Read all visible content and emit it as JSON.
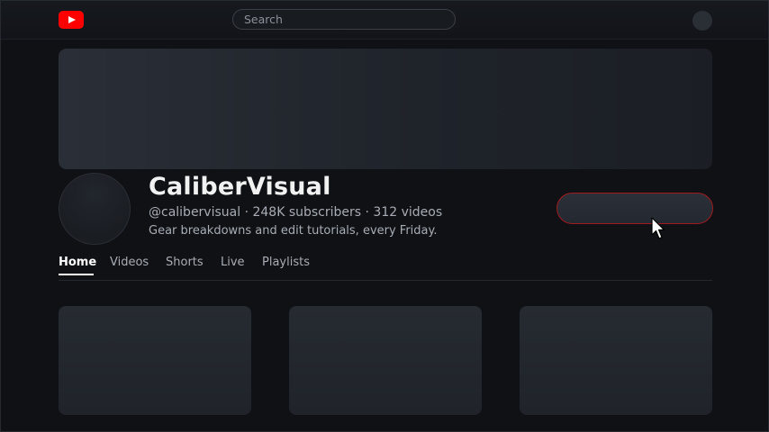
{
  "header": {
    "logo": "youtube-logo",
    "search_placeholder": "Search"
  },
  "channel": {
    "name": "CaliberVisual",
    "meta": "@calibervisual · 248K subscribers · 312 videos",
    "description": "Gear breakdowns and edit tutorials, every Friday."
  },
  "tabs": [
    {
      "label": "Home",
      "active": true
    },
    {
      "label": "Videos"
    },
    {
      "label": "Shorts"
    },
    {
      "label": "Live"
    },
    {
      "label": "Playlists"
    }
  ],
  "colors": {
    "background": "#0f1115",
    "logo_red": "#ff0000",
    "button_outline": "#a01b20"
  }
}
